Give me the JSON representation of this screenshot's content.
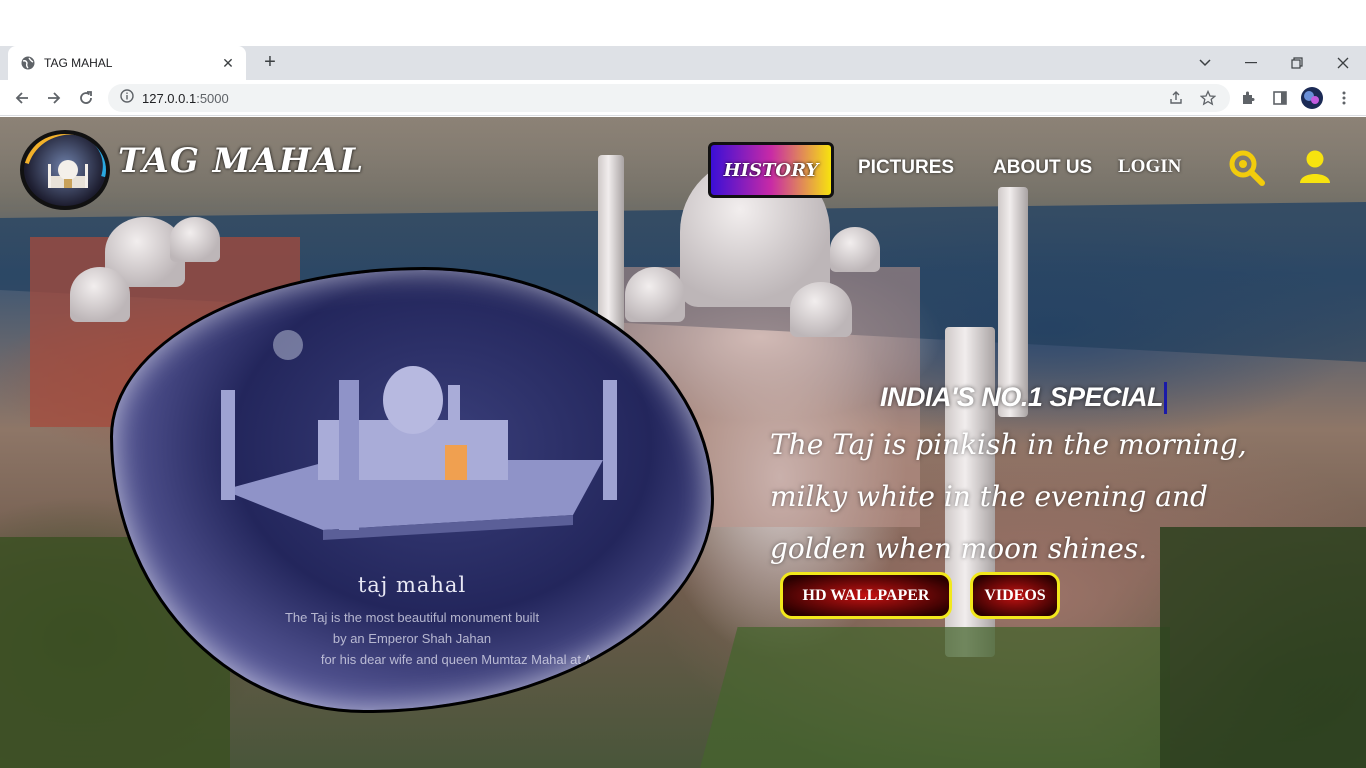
{
  "browser": {
    "tab_title": "TAG MAHAL",
    "url_host": "127.0.0.1",
    "url_port": ":5000",
    "new_tab_label": "+",
    "close_label": "✕"
  },
  "header": {
    "brand": "TAG MAHAL",
    "nav": {
      "history": "HISTORY",
      "pictures": "PICTURES",
      "about": "ABOUT US",
      "login": "LOGIN"
    }
  },
  "card": {
    "title": "taj mahal",
    "lines": [
      "The Taj is the most beautiful monument built",
      "by an Emperor Shah Jahan",
      "for his dear wife and queen Mumtaz Mahal at Agra,India"
    ]
  },
  "hero": {
    "title": "INDIA'S NO.1 SPECIAL",
    "quote": "The Taj is pinkish in the morning, milky white in the evening and golden when moon shines.",
    "buttons": {
      "wallpaper": "HD WALLPAPER",
      "videos": "VIDEOS"
    }
  },
  "colors": {
    "accent_yellow": "#f2e81c",
    "search_icon": "#f2cc0c",
    "user_icon": "#f7e30f"
  },
  "icons": [
    "globe-icon",
    "close-icon",
    "back-icon",
    "forward-icon",
    "reload-icon",
    "info-icon",
    "share-icon",
    "star-icon",
    "extensions-icon",
    "sidepanel-icon",
    "profile-icon",
    "menu-icon",
    "search-icon",
    "user-icon"
  ]
}
